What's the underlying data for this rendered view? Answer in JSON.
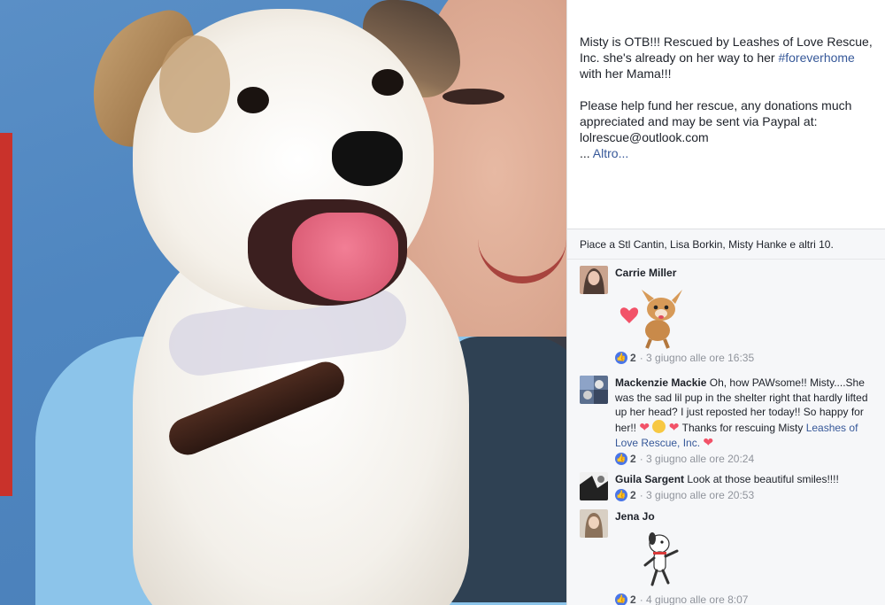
{
  "post": {
    "paragraph1_a": "Misty is OTB!!! Rescued by Leashes of Love Rescue, Inc. she's already on her way to her ",
    "hashtag": "#foreverhome",
    "paragraph1_b": " with her Mama!!!",
    "paragraph2": "Please help fund her rescue, any donations much appreciated and may be sent via Paypal at: lolrescue@outlook.com",
    "more_prefix": "... ",
    "more_link": "Altro..."
  },
  "likes_line": "Piace a Stl Cantin, Lisa Borkin, Misty Hanke e altri 10.",
  "colors": {
    "link": "#365899",
    "like_blue": "#4a76e8",
    "heart": "#f25268",
    "panel_gray": "#f6f7f9"
  },
  "comments": [
    {
      "name": "Carrie Miller",
      "text": "",
      "sticker": "heart-chihuahua-sticker",
      "likes": "2",
      "time": "3 giugno alle ore 16:35"
    },
    {
      "name": "Mackenzie Mackie",
      "text_a": "Oh, how PAWsome!! Misty....She was the sad lil pup in the shelter right that hardly lifted up her head? I just reposted her today!! So happy for her!! ",
      "text_b": " Thanks for rescuing Misty ",
      "link": "Leashes of Love Rescue, Inc.",
      "likes": "2",
      "time": "3 giugno alle ore 20:24"
    },
    {
      "name": "Guila Sargent",
      "text": "Look at those beautiful smiles!!!!",
      "likes": "2",
      "time": "3 giugno alle ore 20:53"
    },
    {
      "name": "Jena Jo",
      "text": "",
      "sticker": "dancing-dog-sticker",
      "likes": "2",
      "time": "4 giugno alle ore 8:07"
    }
  ]
}
